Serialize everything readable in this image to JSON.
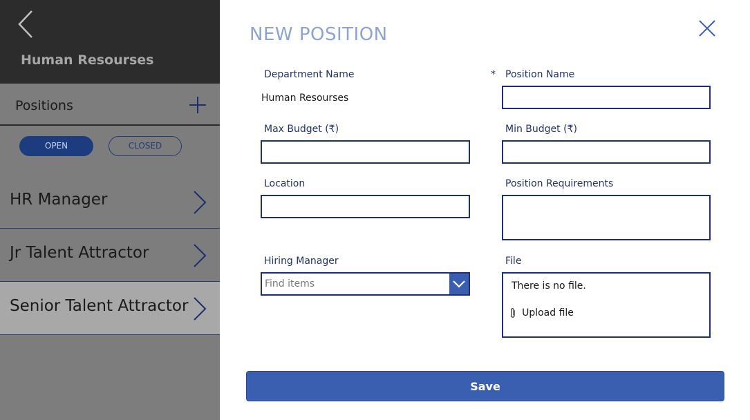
{
  "sidebar": {
    "back_icon": "chevron-left-icon",
    "title": "Human Resourses",
    "section_title": "Positions",
    "add_icon": "plus-icon",
    "filters": [
      {
        "label": "OPEN",
        "active": true
      },
      {
        "label": "CLOSED",
        "active": false
      }
    ],
    "positions": [
      {
        "label": "HR Manager",
        "selected": false
      },
      {
        "label": "Jr Talent Attractor",
        "selected": false
      },
      {
        "label": "Senior Talent Attractor",
        "selected": true
      }
    ]
  },
  "form": {
    "title": "NEW POSITION",
    "close_icon": "close-icon",
    "department": {
      "label": "Department Name",
      "value": "Human Resourses"
    },
    "position_name": {
      "label": "Position Name",
      "required_mark": "*",
      "value": ""
    },
    "max_budget": {
      "label": "Max Budget (₹)",
      "value": ""
    },
    "min_budget": {
      "label": "Min Budget (₹)",
      "value": ""
    },
    "location": {
      "label": "Location",
      "value": ""
    },
    "requirements": {
      "label": "Position Requirements",
      "value": ""
    },
    "hiring_manager": {
      "label": "Hiring Manager",
      "placeholder": "Find items",
      "value": ""
    },
    "file": {
      "label": "File",
      "empty_text": "There is no file.",
      "upload_label": "Upload file"
    },
    "save_label": "Save"
  },
  "colors": {
    "accent": "#3a5fb0",
    "field_border": "#1d2f7a",
    "title": "#8ea3d4",
    "sidebar_header": "#2c2c2c",
    "sidebar_body": "#7d7d7d",
    "selected_row": "#a8a8a8"
  }
}
